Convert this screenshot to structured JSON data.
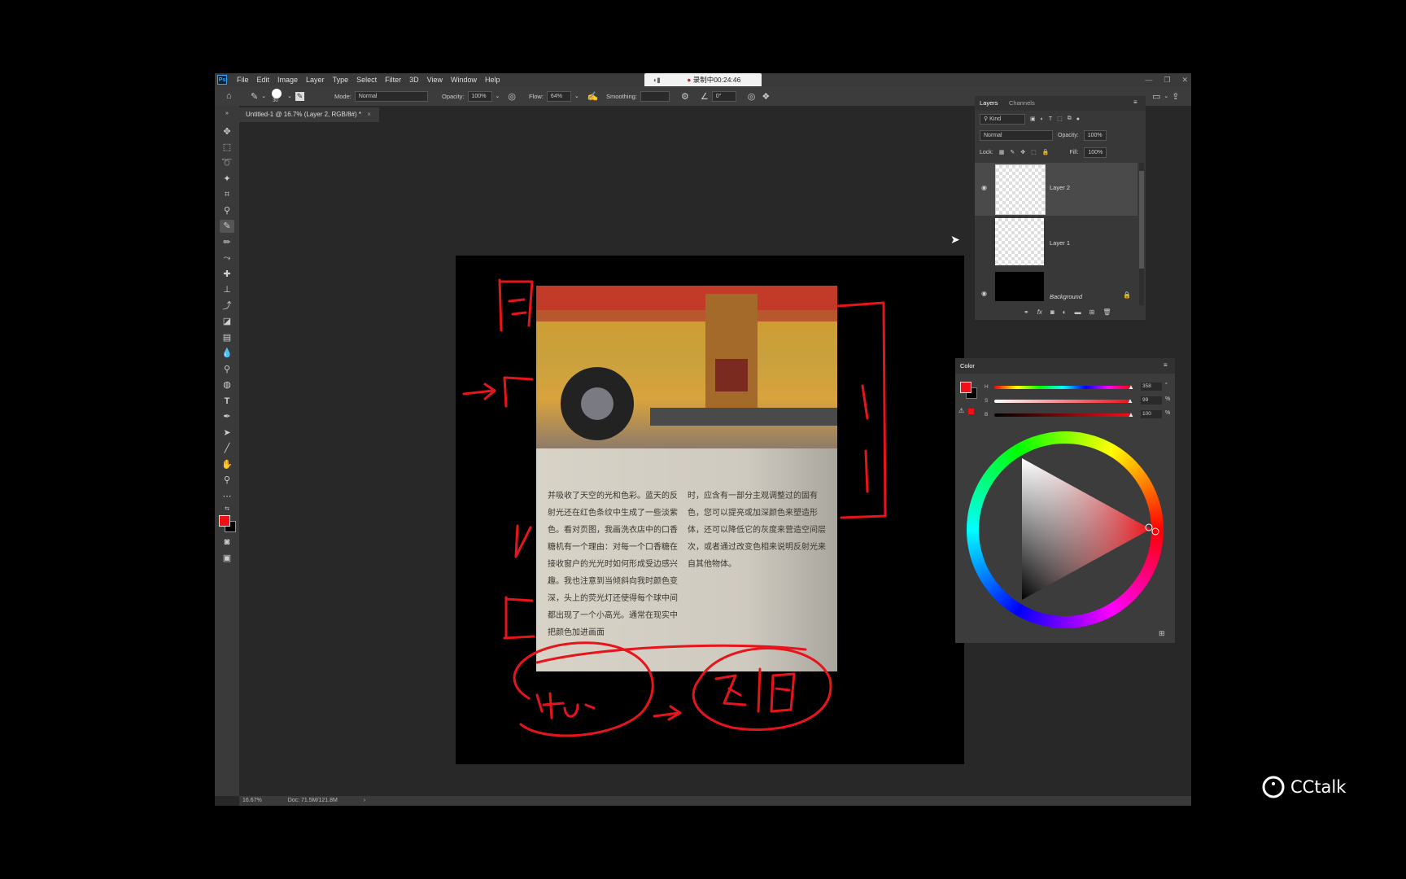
{
  "menubar": {
    "logo": "Ps",
    "items": [
      "File",
      "Edit",
      "Image",
      "Layer",
      "Type",
      "Select",
      "Filter",
      "3D",
      "View",
      "Window",
      "Help"
    ]
  },
  "recording": {
    "label": "录制中00:24:46"
  },
  "options_bar": {
    "brush_size": "30",
    "mode_label": "Mode:",
    "mode_value": "Normal",
    "opacity_label": "Opacity:",
    "opacity_value": "100%",
    "flow_label": "Flow:",
    "flow_value": "64%",
    "smoothing_label": "Smoothing:",
    "angle_value": "0°"
  },
  "document": {
    "tab_title": "Untitled-1 @ 16.7% (Layer 2, RGB/8#) *",
    "text_col1": "并吸收了天空的光和色彩。蓝天的反射光还在红色条纹中生成了一些淡紫色。看对页图，我画洗衣店中的口香糖机有一个理由：对每一个口香糖在接收窗户的光光时如何形成受边感兴趣。我也注意到当倾斜向我时颜色变深，头上的荧光灯还使得每个球中间都出现了一个小高光。通常在现实中把颜色加进画面",
    "text_col2": "时，应含有一部分主观调整过的固有色，您可以提亮或加深颜色来塑造形体，还可以降低它的灰度来营造空间层次，或者通过改变色相来说明反射光来自其他物体。"
  },
  "status": {
    "zoom": "16.67%",
    "doc": "Doc: 71.5M/121.8M"
  },
  "layers_panel": {
    "tabs": [
      "Layers",
      "Channels"
    ],
    "filter_label": "Kind",
    "blend_mode": "Normal",
    "opacity_label": "Opacity:",
    "opacity_value": "100%",
    "lock_label": "Lock:",
    "fill_label": "Fill:",
    "fill_value": "100%",
    "layers": [
      {
        "name": "Layer 2"
      },
      {
        "name": "Layer 1"
      },
      {
        "name": "Background"
      }
    ]
  },
  "color_panel": {
    "title": "Color",
    "h_label": "H",
    "h_value": "358",
    "h_unit": "°",
    "s_label": "S",
    "s_value": "99",
    "s_unit": "%",
    "b_label": "B",
    "b_value": "100",
    "b_unit": "%",
    "foreground": "#f01018",
    "background": "#000000"
  },
  "watermark": {
    "text": "CCtalk"
  },
  "colors": {
    "accent": "#31a8ff",
    "annotation_red": "#e8141c"
  }
}
